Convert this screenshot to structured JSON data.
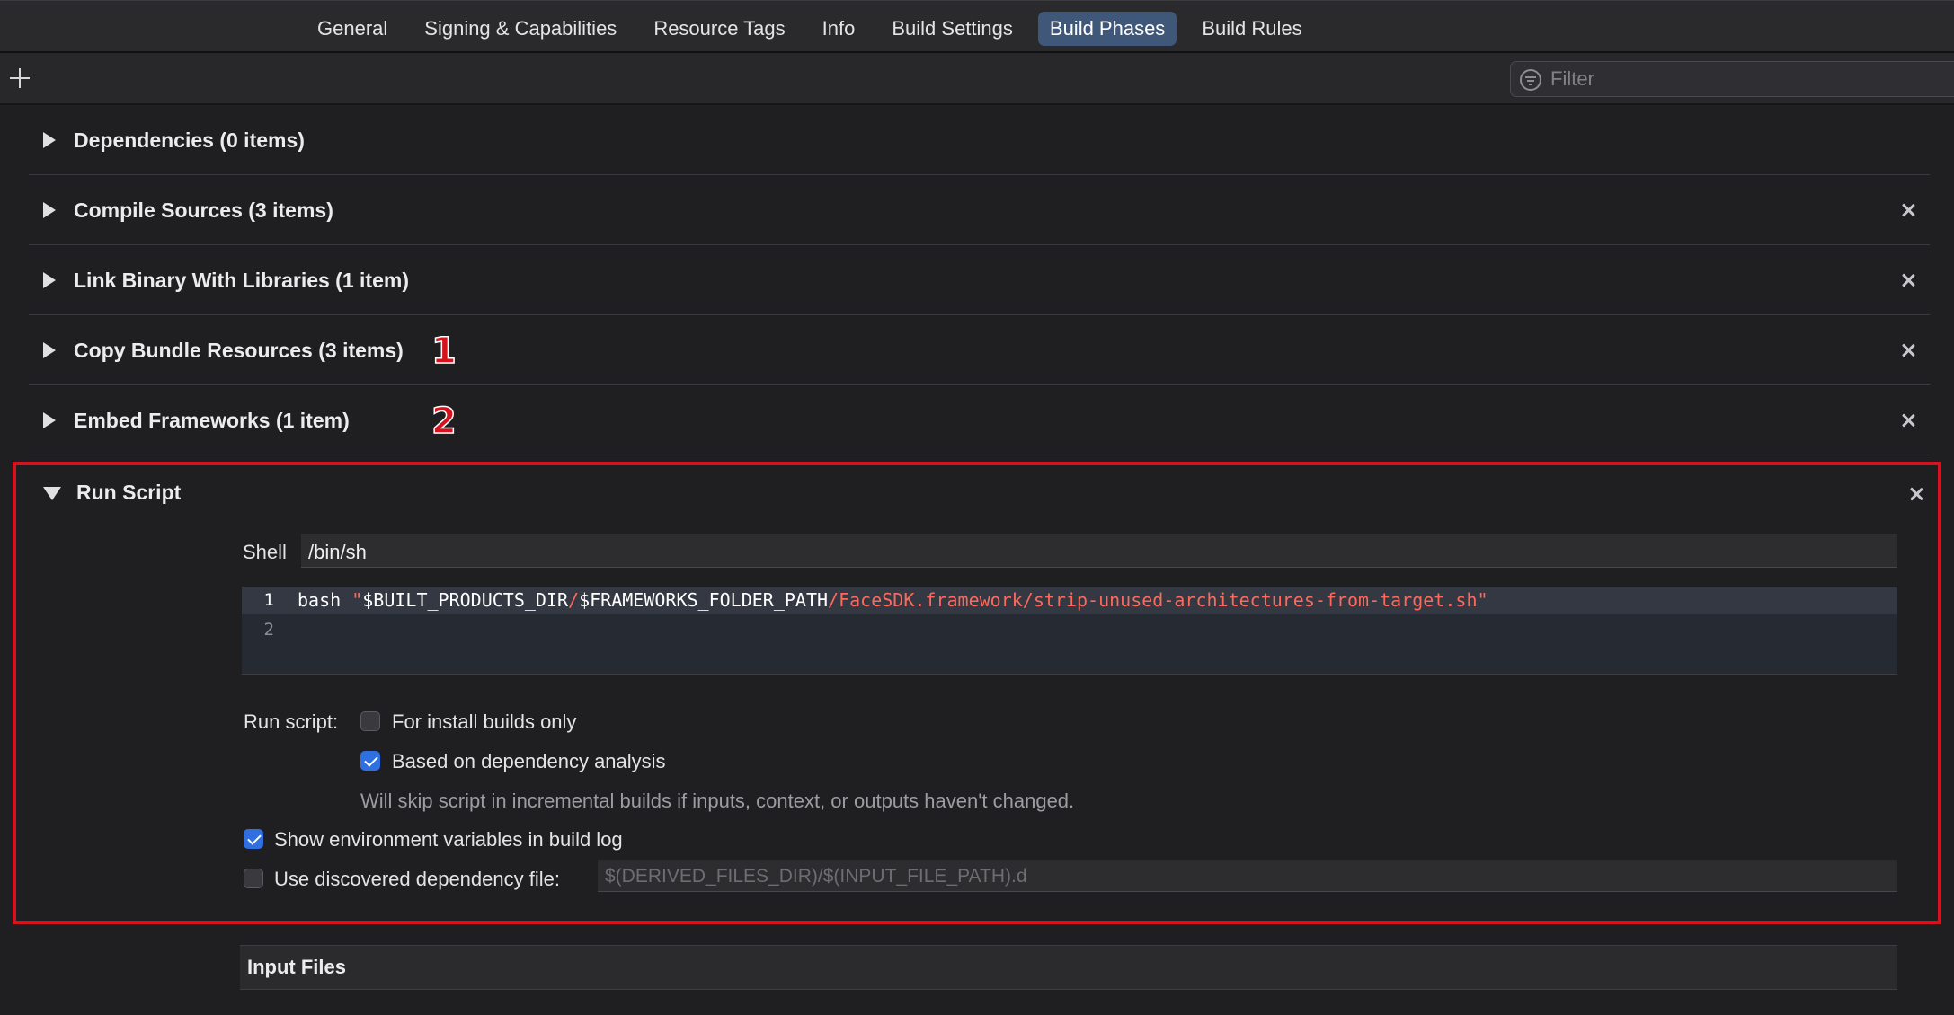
{
  "tabs": [
    {
      "label": "General"
    },
    {
      "label": "Signing & Capabilities"
    },
    {
      "label": "Resource Tags"
    },
    {
      "label": "Info"
    },
    {
      "label": "Build Settings"
    },
    {
      "label": "Build Phases"
    },
    {
      "label": "Build Rules"
    }
  ],
  "active_tab": "Build Phases",
  "toolbar": {
    "add_icon": "plus-icon",
    "filter_placeholder": "Filter",
    "filter_icon": "filter-icon"
  },
  "phases": [
    {
      "title": "Dependencies (0 items)",
      "removable": false
    },
    {
      "title": "Compile Sources (3 items)",
      "removable": true
    },
    {
      "title": "Link Binary With Libraries (1 item)",
      "removable": true
    },
    {
      "title": "Copy Bundle Resources (3 items)",
      "removable": true,
      "marker": "1"
    },
    {
      "title": "Embed Frameworks (1 item)",
      "removable": true,
      "marker": "2"
    }
  ],
  "run_script": {
    "title": "Run Script",
    "shell_label": "Shell",
    "shell_value": "/bin/sh",
    "code_lines": [
      {
        "number": "1",
        "cmd": "bash ",
        "q1": "\"",
        "var1": "$BUILT_PRODUCTS_DIR",
        "sep": "/",
        "var2": "$FRAMEWORKS_FOLDER_PATH",
        "rest": "/FaceSDK.framework/strip-unused-architectures-from-target.sh\""
      },
      {
        "number": "2"
      }
    ],
    "run_script_label": "Run script:",
    "install_builds_only": {
      "label": "For install builds only",
      "checked": false
    },
    "dependency_analysis": {
      "label": "Based on dependency analysis",
      "checked": true
    },
    "dependency_hint": "Will skip script in incremental builds if inputs, context, or outputs haven't changed.",
    "show_env_vars": {
      "label": "Show environment variables in build log",
      "checked": true
    },
    "discovered_dep_file": {
      "label": "Use discovered dependency file:",
      "checked": false,
      "placeholder": "$(DERIVED_FILES_DIR)/$(INPUT_FILE_PATH).d"
    }
  },
  "input_files": {
    "title": "Input Files"
  },
  "colors": {
    "background": "#1f1f22",
    "active_tab": "#3f5778",
    "highlight_border": "#d4131f",
    "string_literal": "#fc6a5d",
    "checkbox_on": "#2f6fe0"
  }
}
